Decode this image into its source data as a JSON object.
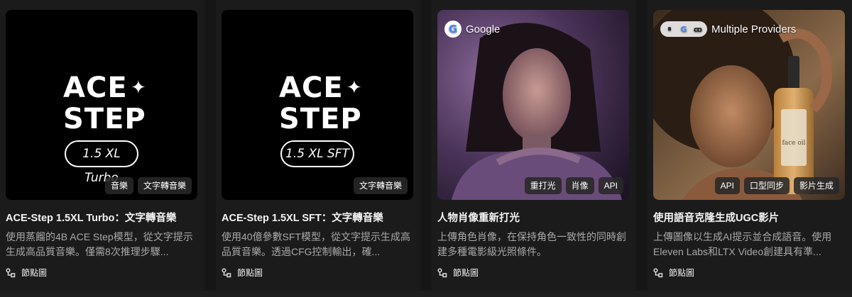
{
  "cards": [
    {
      "title": "ACE-Step 1.5XL Turbo：文字轉音樂",
      "description": "使用蒸餾的4B ACE Step模型，從文字提示生成高品質音樂。僅需8次推理步驟...",
      "node_label": "節點圖",
      "tags": [
        "音樂",
        "文字轉音樂"
      ],
      "logo": {
        "line1": "ACE",
        "line2": "STEP",
        "variant": "1.5 XL Turbo"
      }
    },
    {
      "title": "ACE-Step 1.5XL SFT：文字轉音樂",
      "description": "使用40億參數SFT模型，從文字提示生成高品質音樂。透過CFG控制輸出，確...",
      "node_label": "節點圖",
      "tags": [
        "文字轉音樂"
      ],
      "logo": {
        "line1": "ACE",
        "line2": "STEP",
        "variant": "1.5 XL SFT"
      }
    },
    {
      "title": "人物肖像重新打光",
      "description": "上傳角色肖像，在保持角色一致性的同時創建多種電影級光照條件。",
      "node_label": "節點圖",
      "tags": [
        "重打光",
        "肖像",
        "API"
      ],
      "provider": "Google"
    },
    {
      "title": "使用語音克隆生成UGC影片",
      "description": "上傳圖像以生成AI提示並合成語音。使用Eleven Labs和LTX Video創建具有準...",
      "node_label": "節點圖",
      "tags": [
        "API",
        "口型同步",
        "影片生成"
      ],
      "provider": "Multiple Providers",
      "bottle_label": "face oil"
    }
  ],
  "colors": {
    "background": "#161616",
    "tag_bg": "#282828",
    "muted_text": "#a9a9a9"
  }
}
